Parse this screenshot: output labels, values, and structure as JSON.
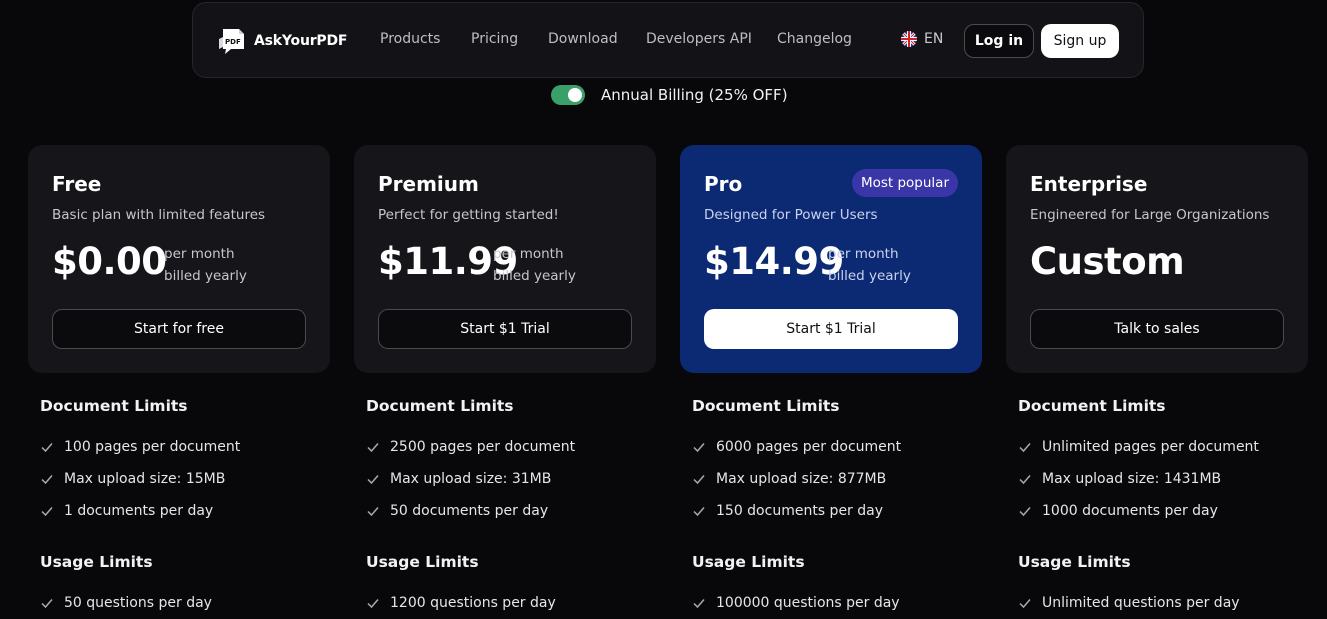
{
  "nav": {
    "brand": "AskYourPDF",
    "links": [
      "Products",
      "Pricing",
      "Download",
      "Developers API",
      "Changelog"
    ],
    "language": "EN",
    "login_label": "Log in",
    "signup_label": "Sign up"
  },
  "billing": {
    "toggle_on": true,
    "label": "Annual Billing (25% OFF)"
  },
  "plans": [
    {
      "name": "Free",
      "description": "Basic plan with limited features",
      "price": "$0.00",
      "per_line1": "per month",
      "per_line2": "billed yearly",
      "cta": "Start for free",
      "document_limits_title": "Document Limits",
      "document_limits": [
        "100 pages per document",
        "Max upload size: 15MB",
        "1 documents per day"
      ],
      "usage_limits_title": "Usage Limits",
      "usage_limits": [
        "50 questions per day"
      ]
    },
    {
      "name": "Premium",
      "description": "Perfect for getting started!",
      "price": "$11.99",
      "per_line1": "per month",
      "per_line2": "billed yearly",
      "cta": "Start $1 Trial",
      "document_limits_title": "Document Limits",
      "document_limits": [
        "2500 pages per document",
        "Max upload size: 31MB",
        "50 documents per day"
      ],
      "usage_limits_title": "Usage Limits",
      "usage_limits": [
        "1200 questions per day"
      ]
    },
    {
      "name": "Pro",
      "badge": "Most popular",
      "description": "Designed for Power Users",
      "price": "$14.99",
      "per_line1": "per month",
      "per_line2": "billed yearly",
      "cta": "Start $1 Trial",
      "document_limits_title": "Document Limits",
      "document_limits": [
        "6000 pages per document",
        "Max upload size: 877MB",
        "150 documents per day"
      ],
      "usage_limits_title": "Usage Limits",
      "usage_limits": [
        "100000 questions per day"
      ]
    },
    {
      "name": "Enterprise",
      "description": "Engineered for Large Organizations",
      "price": "Custom",
      "cta": "Talk to sales",
      "document_limits_title": "Document Limits",
      "document_limits": [
        "Unlimited pages per document",
        "Max upload size: 1431MB",
        "1000 documents per day"
      ],
      "usage_limits_title": "Usage Limits",
      "usage_limits": [
        "Unlimited questions per day"
      ]
    }
  ],
  "colors": {
    "background": "#08080b",
    "card": "#15151a",
    "pro_card": "#0c2a73",
    "badge": "#3a36a8",
    "toggle": "#3aa06a"
  },
  "icons": [
    "pdf-logo-icon",
    "uk-flag-icon",
    "check-icon"
  ]
}
